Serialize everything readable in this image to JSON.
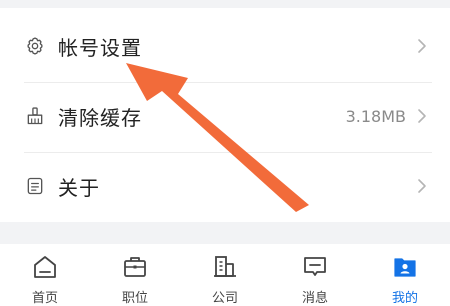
{
  "settings": {
    "items": [
      {
        "label": "帐号设置",
        "icon": "gear-icon"
      },
      {
        "label": "清除缓存",
        "value": "3.18MB",
        "icon": "broom-icon"
      },
      {
        "label": "关于",
        "icon": "document-icon"
      }
    ]
  },
  "tab_bar": {
    "tabs": [
      {
        "label": "首页",
        "icon": "home-icon"
      },
      {
        "label": "职位",
        "icon": "briefcase-icon"
      },
      {
        "label": "公司",
        "icon": "building-icon"
      },
      {
        "label": "消息",
        "icon": "message-icon"
      },
      {
        "label": "我的",
        "icon": "profile-icon",
        "active": true
      }
    ]
  },
  "colors": {
    "accent": "#1473e6",
    "annotation_arrow": "#f26b3a",
    "page_background": "#f2f3f5",
    "text_primary": "#222222",
    "text_secondary": "#8a8a8a"
  }
}
